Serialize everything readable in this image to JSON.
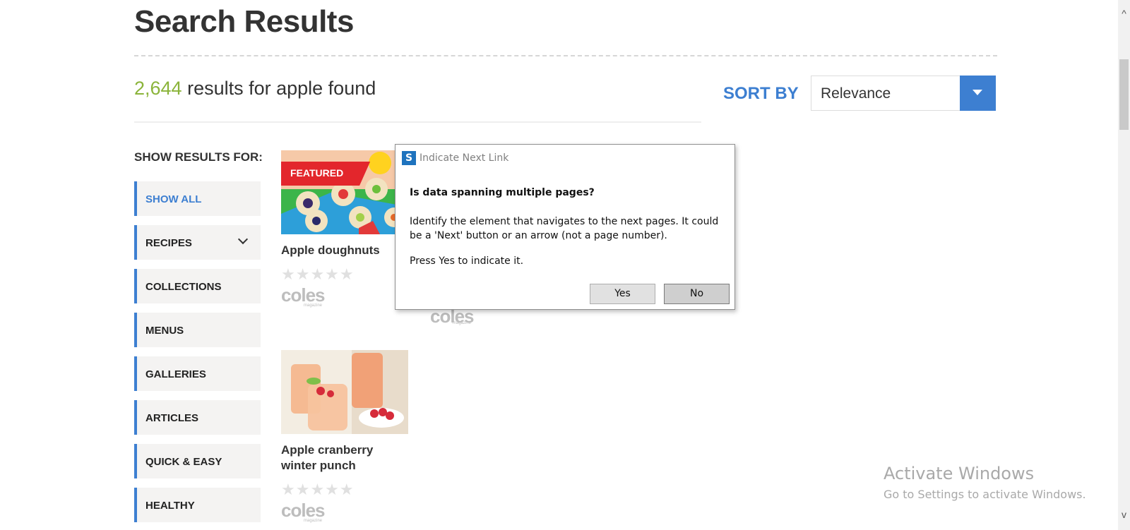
{
  "page": {
    "title": "Search Results"
  },
  "results": {
    "count": "2,644",
    "text": " results for apple found"
  },
  "sort": {
    "label": "SORT BY",
    "selected": "Relevance"
  },
  "filters": {
    "heading": "SHOW RESULTS FOR:",
    "items": [
      {
        "label": "SHOW ALL"
      },
      {
        "label": "RECIPES"
      },
      {
        "label": "COLLECTIONS"
      },
      {
        "label": "MENUS"
      },
      {
        "label": "GALLERIES"
      },
      {
        "label": "ARTICLES"
      },
      {
        "label": "QUICK & EASY"
      },
      {
        "label": "HEALTHY"
      }
    ]
  },
  "cards": [
    {
      "badge": "FEATURED",
      "name": "Apple doughnuts",
      "stars": "★★★★★",
      "brand": "coles",
      "brand_sub": "magazine"
    },
    {
      "name": "Apple cranberry winter punch",
      "stars": "★★★★★",
      "brand": "coles",
      "brand_sub": "magazine"
    }
  ],
  "ghost": {
    "brand": "coles",
    "brand_sub": "magazine"
  },
  "dialog": {
    "icon": "S",
    "title": "Indicate Next Link",
    "question": "Is data spanning multiple pages?",
    "body": "Identify the element that navigates to the next pages. It could be a 'Next' button or an arrow (not a page number).",
    "hint": "Press Yes to indicate it.",
    "yes_label": "Yes",
    "no_label": "No"
  },
  "watermark": {
    "title": "Activate Windows",
    "subtitle": "Go to Settings to activate Windows."
  },
  "scrollbar": {
    "up": "^",
    "down": "v"
  }
}
